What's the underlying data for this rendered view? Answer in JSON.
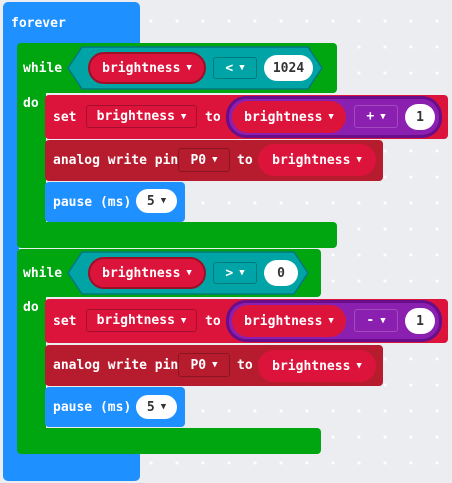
{
  "blocks": {
    "forever_label": "forever",
    "loop1": {
      "while_label": "while",
      "do_label": "do",
      "condition": {
        "variable": "brightness",
        "operator": "<",
        "value": "1024"
      },
      "set": {
        "set_label": "set",
        "variable": "brightness",
        "to_label": "to",
        "expr_variable": "brightness",
        "expr_operator": "+",
        "expr_value": "1"
      },
      "analog": {
        "label": "analog write pin",
        "pin": "P0",
        "to_label": "to",
        "variable": "brightness"
      },
      "pause": {
        "label": "pause (ms)",
        "value": "5"
      }
    },
    "loop2": {
      "while_label": "while",
      "do_label": "do",
      "condition": {
        "variable": "brightness",
        "operator": ">",
        "value": "0"
      },
      "set": {
        "set_label": "set",
        "variable": "brightness",
        "to_label": "to",
        "expr_variable": "brightness",
        "expr_operator": "-",
        "expr_value": "1"
      },
      "analog": {
        "label": "analog write pin",
        "pin": "P0",
        "to_label": "to",
        "variable": "brightness"
      },
      "pause": {
        "label": "pause (ms)",
        "value": "5"
      }
    }
  },
  "icons": {
    "dropdown": "caret-down-icon"
  },
  "colors": {
    "events": "#1e90ff",
    "loops": "#00a60f",
    "logic": "#00a4a6",
    "variables": "#dc143c",
    "math": "#8a1fb0",
    "pins": "#b71c2e",
    "workspace": "#ecedf1"
  }
}
